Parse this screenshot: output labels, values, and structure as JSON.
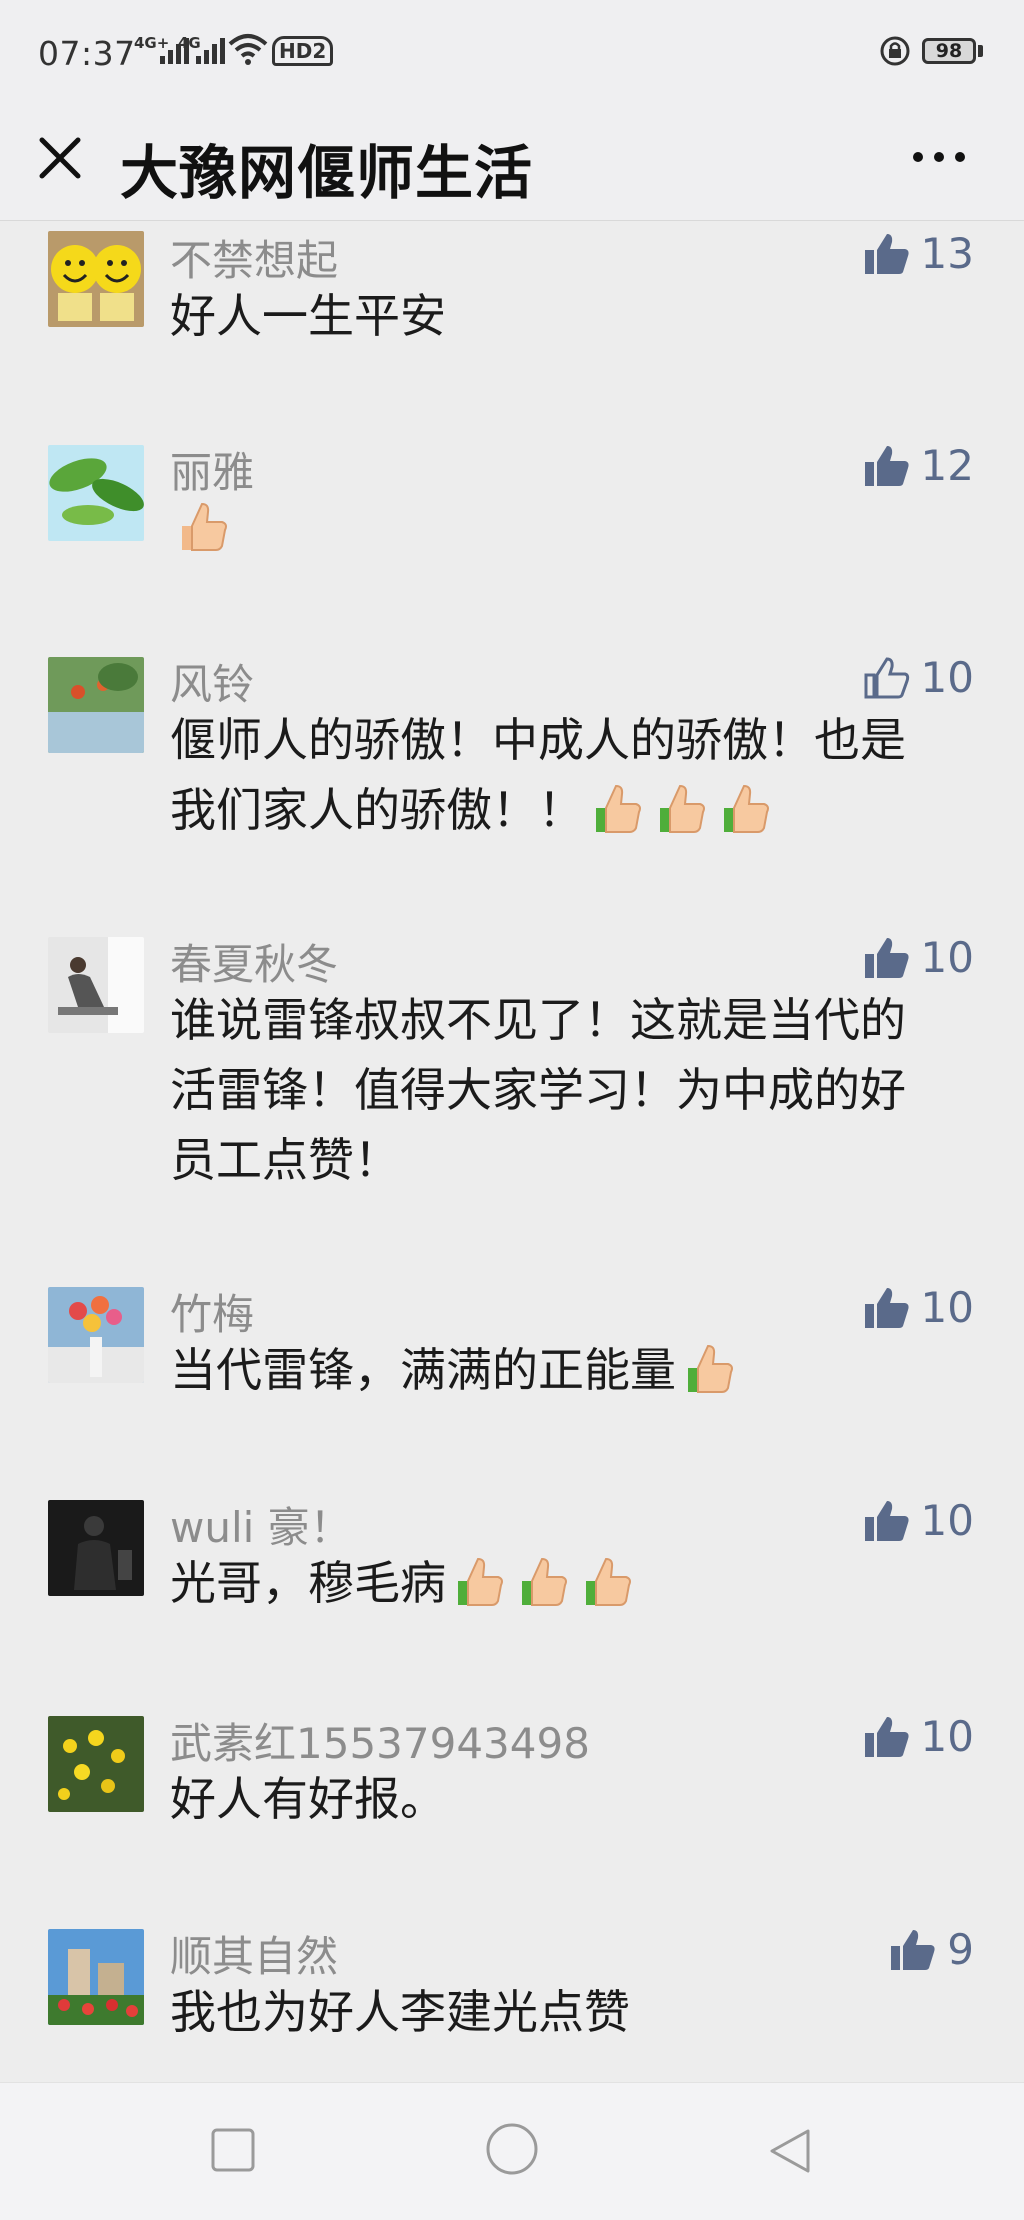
{
  "status": {
    "time": "07:37",
    "net1": "4G+",
    "net2": "4G",
    "hd": "HD2",
    "battery": "98"
  },
  "nav": {
    "title": "大豫网偃师生活"
  },
  "comments": [
    {
      "name": "不禁想起",
      "text": "好人一生平安",
      "likes": "13",
      "liked": true,
      "avatar": "smiley-avatar"
    },
    {
      "name": "丽雅",
      "text": "",
      "emoji_count": 1,
      "likes": "12",
      "liked": true,
      "avatar": "leaves-avatar"
    },
    {
      "name": "风铃",
      "text_line1": "偃师人的骄傲！中成人的骄傲！也是",
      "text_line2": "我们家人的骄傲！！",
      "emoji_count": 3,
      "likes": "10",
      "liked": false,
      "avatar": "garden-avatar"
    },
    {
      "name": "春夏秋冬",
      "text_line1": "谁说雷锋叔叔不见了！这就是当代的",
      "text_line2": "活雷锋！值得大家学习！为中成的好",
      "text_line3": "员工点赞！",
      "likes": "10",
      "liked": true,
      "avatar": "reading-avatar"
    },
    {
      "name": "竹梅",
      "text": "当代雷锋，满满的正能量",
      "emoji_count": 1,
      "likes": "10",
      "liked": true,
      "avatar": "flowers-avatar"
    },
    {
      "name": "wuli 豪！",
      "text": "光哥，穆毛病",
      "emoji_count": 3,
      "likes": "10",
      "liked": true,
      "avatar": "dark-avatar"
    },
    {
      "name": "武素红15537943498",
      "text": "好人有好报。",
      "likes": "10",
      "liked": true,
      "avatar": "yellow-flowers-avatar"
    },
    {
      "name": "顺其自然",
      "text": "我也为好人李建光点赞",
      "likes": "9",
      "liked": true,
      "avatar": "building-avatar"
    }
  ],
  "colors": {
    "background": "#ededed",
    "like_blue": "#5a6a8a",
    "name_gray": "#8c8c8c"
  }
}
